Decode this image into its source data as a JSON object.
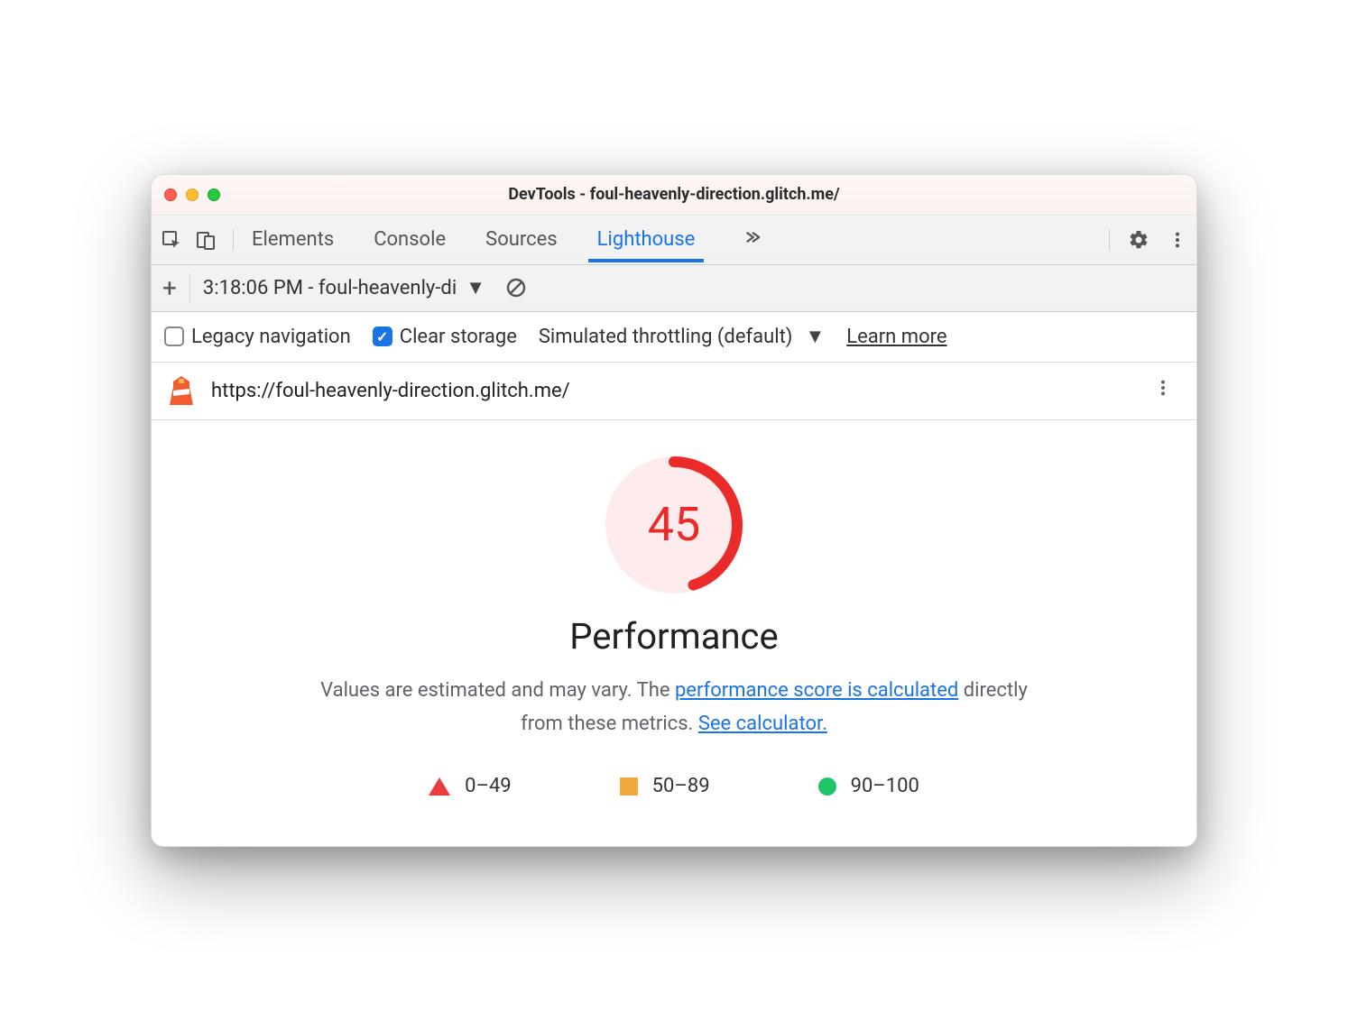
{
  "window": {
    "title": "DevTools - foul-heavenly-direction.glitch.me/"
  },
  "tabs": {
    "elements": "Elements",
    "console": "Console",
    "sources": "Sources",
    "lighthouse": "Lighthouse"
  },
  "subbar": {
    "report_label": "3:18:06 PM - foul-heavenly-di"
  },
  "options": {
    "legacy_nav": "Legacy navigation",
    "clear_storage": "Clear storage",
    "throttling": "Simulated throttling (default)",
    "learn_more": "Learn more"
  },
  "report": {
    "url": "https://foul-heavenly-direction.glitch.me/"
  },
  "performance": {
    "score": "45",
    "title": "Performance",
    "desc_prefix": "Values are estimated and may vary. The ",
    "link1": "performance score is calculated",
    "desc_middle": " directly from these metrics. ",
    "link2": "See calculator."
  },
  "legend": {
    "r1": "0–49",
    "r2": "50–89",
    "r3": "90–100"
  },
  "colors": {
    "score_stroke": "#eb2a2a"
  }
}
